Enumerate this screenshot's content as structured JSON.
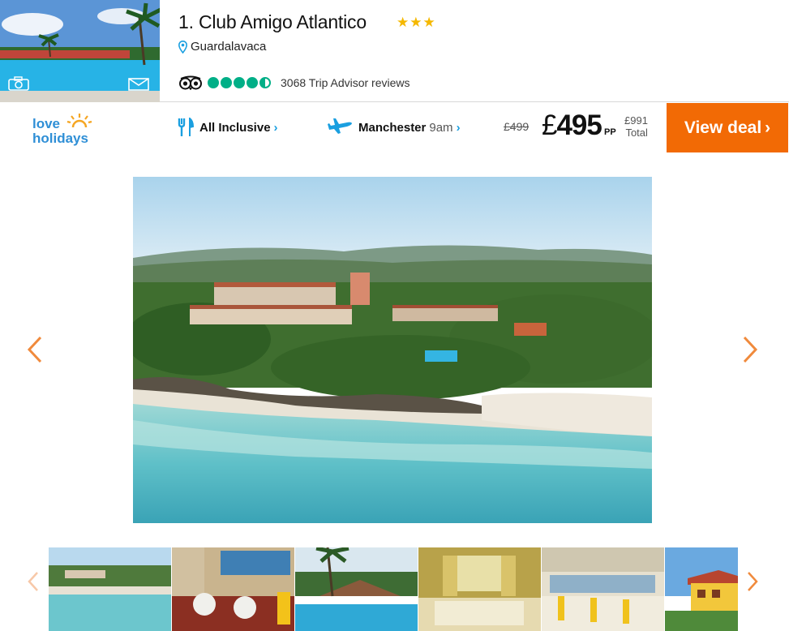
{
  "hotel": {
    "title": "1. Club Amigo Atlantico",
    "stars": "★★★",
    "location": "Guardalavaca",
    "rating_bubbles": 4.5,
    "reviews_text": "3068 Trip Advisor reviews"
  },
  "logo": {
    "line1": "love",
    "line2": "holidays"
  },
  "deal": {
    "board": "All Inclusive",
    "airport": "Manchester",
    "time": "9am",
    "old_price": "£499",
    "currency": "£",
    "price": "495",
    "pp": "PP",
    "total_price": "£991",
    "total_label": "Total",
    "cta": "View deal",
    "cta_chevron": "›"
  },
  "icons": {
    "camera": "camera-icon",
    "mail": "mail-icon",
    "pin": "map-pin-icon",
    "tripadvisor": "tripadvisor-owl-icon",
    "board": "cutlery-icon",
    "flight": "plane-icon",
    "prev": "chevron-left-icon",
    "next": "chevron-right-icon"
  },
  "colors": {
    "accent_orange": "#f26a05",
    "link_blue": "#1a9fe0",
    "star_gold": "#f5b800",
    "tripadvisor_green": "#00af87",
    "arrow_orange": "#f08a3c"
  },
  "gallery": {
    "thumbnail_count": 6,
    "thumbnails": [
      "aerial-resort",
      "restaurant",
      "pool",
      "bedroom",
      "dining-hall",
      "villa"
    ]
  }
}
